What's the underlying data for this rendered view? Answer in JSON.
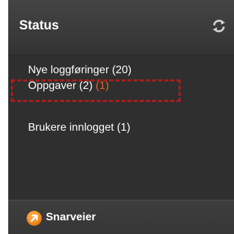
{
  "status_panel": {
    "title": "Status",
    "refresh_icon": "refresh-icon",
    "items": [
      {
        "label": "Nye loggføringer (20)"
      },
      {
        "label": "Oppgaver (2)",
        "new_count": "(1)"
      },
      {
        "label": "Brukere innlogget (1)"
      }
    ]
  },
  "shortcuts": {
    "label": "Snarveier",
    "icon": "arrow-circle-icon"
  },
  "colors": {
    "panel_bg": "#2f2f2f",
    "text": "#ffffff",
    "new_count": "#e8642a",
    "highlight": "#b01c1c",
    "footer_icon": "#f08a1c"
  }
}
